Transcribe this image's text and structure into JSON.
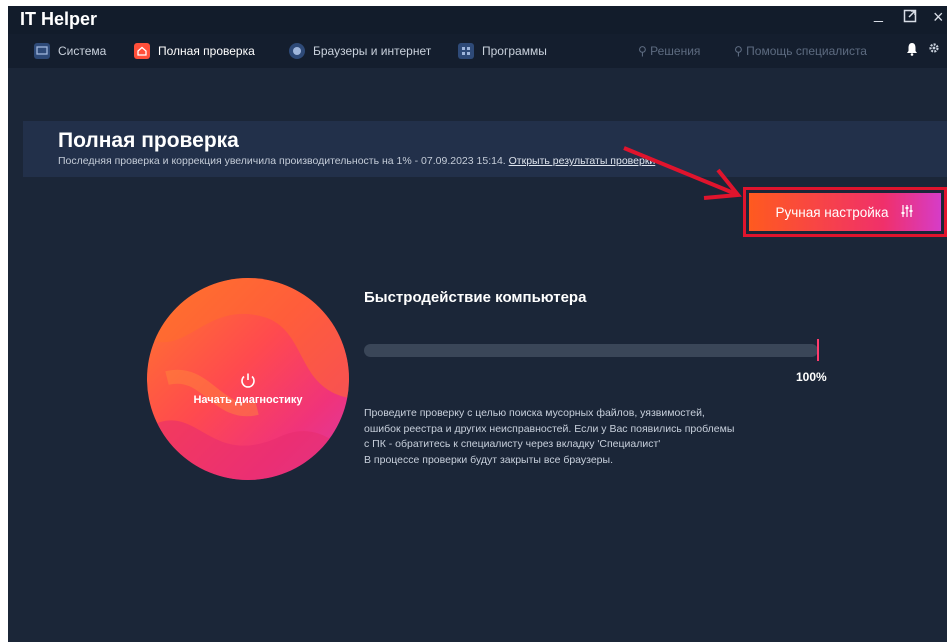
{
  "app": {
    "title": "IT Helper"
  },
  "window_controls": {
    "minimize": "_",
    "maximize": "⧉",
    "close": "×"
  },
  "nav": {
    "items": [
      {
        "label": "Система",
        "icon": "monitor-icon"
      },
      {
        "label": "Полная проверка",
        "icon": "home-icon",
        "active": true
      },
      {
        "label": "Браузеры и интернет",
        "icon": "globe-icon"
      },
      {
        "label": "Программы",
        "icon": "apps-icon"
      }
    ],
    "solutions": "Решения",
    "specialist_help": "Помощь специалиста"
  },
  "banner": {
    "title": "Полная проверка",
    "subtitle": "Последняя проверка и коррекция увеличила производительность на 1% - 07.09.2023 15:14.",
    "link": "Открыть результаты проверки"
  },
  "manual_button": {
    "label": "Ручная настройка"
  },
  "diagnostic": {
    "label": "Начать диагностику"
  },
  "performance": {
    "title": "Быстродействие компьютера",
    "percent_text": "100%",
    "progress": 1.0
  },
  "description": [
    "Проведите проверку с целью поиска мусорных файлов, уязвимостей,",
    "ошибок реестра и других неисправностей. Если у Вас появились проблемы",
    "с ПК - обратитесь к специалисту через вкладку 'Специалист'",
    "В процессе проверки будут закрыты все браузеры."
  ],
  "colors": {
    "background": "#1b2638",
    "accent_orange": "#ff5a1f",
    "accent_pink": "#f0306a",
    "highlight_red": "#e0142d"
  }
}
